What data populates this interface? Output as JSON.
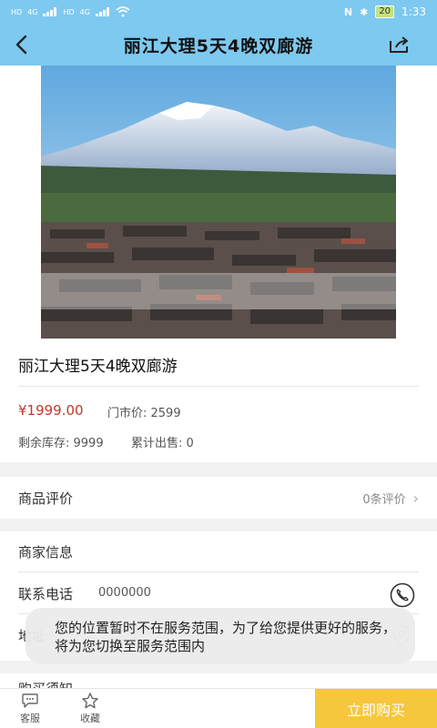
{
  "status_bar": {
    "left_indicators": [
      "HD",
      "4G",
      "HD",
      "4G"
    ],
    "battery": "20",
    "time": "1:33"
  },
  "nav": {
    "title": "丽江大理5天4晚双廊游"
  },
  "product": {
    "title": "丽江大理5天4晚双廊游",
    "price": "¥1999.00",
    "original_price": "门市价: 2599",
    "stock": "剩余库存: 9999",
    "sold": "累计出售: 0"
  },
  "reviews": {
    "label": "商品评价",
    "count": "0条评价"
  },
  "merchant": {
    "title": "商家信息",
    "phone_label": "联系电话",
    "phone": "0000000",
    "address_label": "地址"
  },
  "notice": {
    "label": "购买须知"
  },
  "toast": {
    "message": "您的位置暂时不在服务范围，为了给您提供更好的服务，将为您切换至服务范围内"
  },
  "bottom_bar": {
    "service_label": "客服",
    "favorite_label": "收藏",
    "buy_label": "立即购买"
  },
  "colors": {
    "header": "#7ec9ef",
    "price": "#c0392b",
    "buy_button": "#f6c63c"
  }
}
